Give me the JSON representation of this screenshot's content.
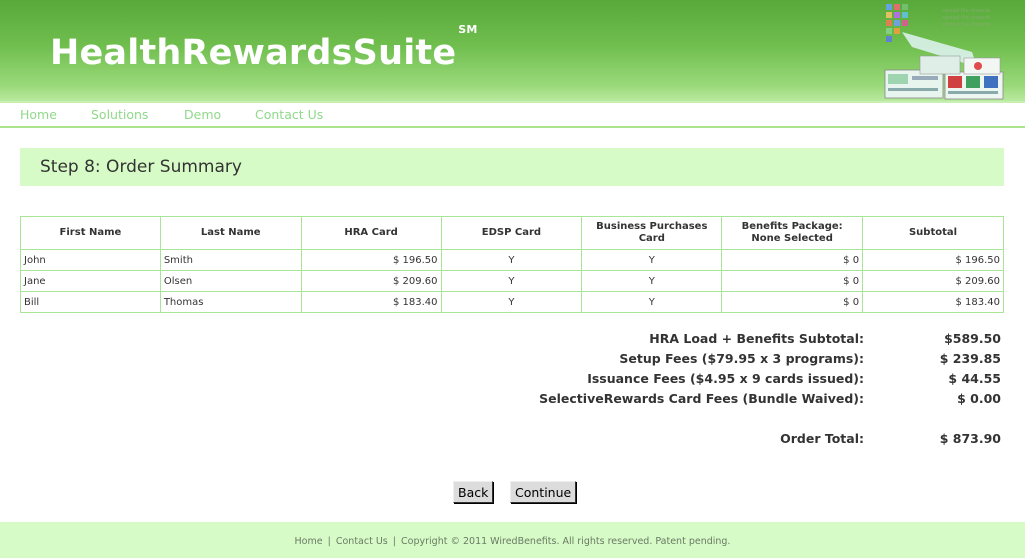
{
  "header": {
    "brand": "HealthRewardsSuite",
    "brand_mark": "SM",
    "tagline": [
      "spread the rewards",
      "spread the rewards",
      "spread the rewards"
    ]
  },
  "nav": {
    "items": [
      {
        "label": "Home"
      },
      {
        "label": "Solutions"
      },
      {
        "label": "Demo"
      },
      {
        "label": "Contact Us"
      }
    ]
  },
  "step": {
    "title": "Step 8: Order Summary"
  },
  "table": {
    "headers": [
      "First Name",
      "Last Name",
      "HRA Card",
      "EDSP Card",
      "Business Purchases Card",
      "Benefits Package: None Selected",
      "Subtotal"
    ],
    "header_lines": {
      "business_1": "Business Purchases",
      "business_2": "Card",
      "benefits_1": "Benefits Package:",
      "benefits_2": "None Selected"
    },
    "rows": [
      [
        "John",
        "Smith",
        "$ 196.50",
        "Y",
        "Y",
        "$ 0",
        "$ 196.50"
      ],
      [
        "Jane",
        "Olsen",
        "$ 209.60",
        "Y",
        "Y",
        "$ 0",
        "$ 209.60"
      ],
      [
        "Bill",
        "Thomas",
        "$ 183.40",
        "Y",
        "Y",
        "$ 0",
        "$ 183.40"
      ]
    ]
  },
  "summary": {
    "hra_label": "HRA Load + Benefits Subtotal:",
    "hra_value": "$589.50",
    "setup_label": "Setup Fees ($79.95 x 3 programs):",
    "setup_value": "$ 239.85",
    "issuance_label": "Issuance Fees ($4.95 x 9 cards issued):",
    "issuance_value": "$ 44.55",
    "selective_label": "SelectiveRewards Card Fees (Bundle Waived):",
    "selective_value": "$ 0.00",
    "total_label": "Order Total:",
    "total_value": "$ 873.90"
  },
  "buttons": {
    "back": "Back",
    "continue": "Continue"
  },
  "footer": {
    "home": "Home",
    "sep": "|",
    "contact": "Contact Us",
    "copyright": "Copyright © 2011 WiredBenefits. All rights reserved. Patent pending."
  },
  "colors": {
    "header_green": "#6fbe4e",
    "nav_link": "#8fd98a",
    "panel_green": "#d6fbc6",
    "table_border": "#a9e596"
  }
}
